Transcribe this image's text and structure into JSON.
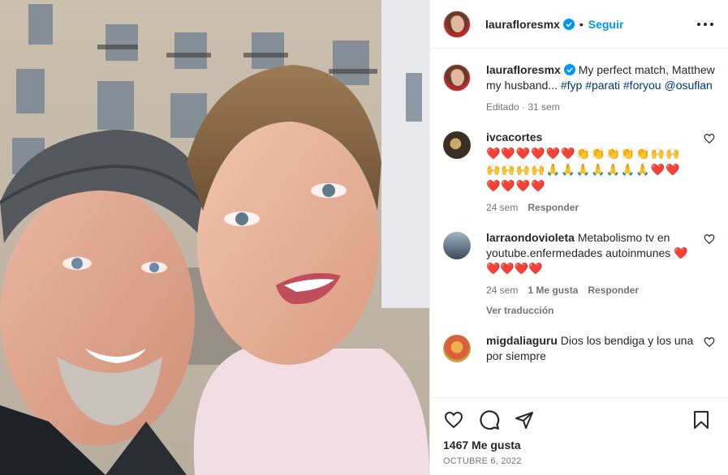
{
  "post": {
    "author": "laurafloresmx",
    "follow_label": "Seguir",
    "separator": "•",
    "caption": {
      "text_before_tags": "My perfect match, Matthew my husband...",
      "tags": [
        "#fyp",
        "#parati",
        "#foryou",
        "@osuflan"
      ],
      "meta": "Editado · 31 sem"
    },
    "likes": "1467 Me gusta",
    "date": "OCTUBRE 6, 2022"
  },
  "comments": [
    {
      "user": "ivcacortes",
      "text": "❤️❤️❤️❤️❤️❤️👏👏👏👏👏🙌🙌🙌🙌🙌🙌🙏🙏🙏🙏🙏🙏🙏❤️❤️❤️❤️❤️❤️",
      "time": "24 sem",
      "reply": "Responder"
    },
    {
      "user": "larraondovioleta",
      "text": "Metabolismo tv en youtube.enfermedades autoinmunes ❤️❤️❤️❤️❤️",
      "time": "24 sem",
      "likes": "1 Me gusta",
      "reply": "Responder",
      "translate": "Ver traducción"
    },
    {
      "user": "migdaliaguru",
      "text": "Dios los bendiga y los una por siempre",
      "time": "",
      "reply": ""
    }
  ],
  "icons": {
    "verified": "verified-badge-icon",
    "more": "more-options-icon",
    "like": "heart-icon",
    "comment": "comment-icon",
    "share": "share-icon",
    "save": "bookmark-icon"
  },
  "colors": {
    "link": "#0095f6",
    "tag": "#00376b",
    "muted": "#737373",
    "text": "#262626"
  }
}
